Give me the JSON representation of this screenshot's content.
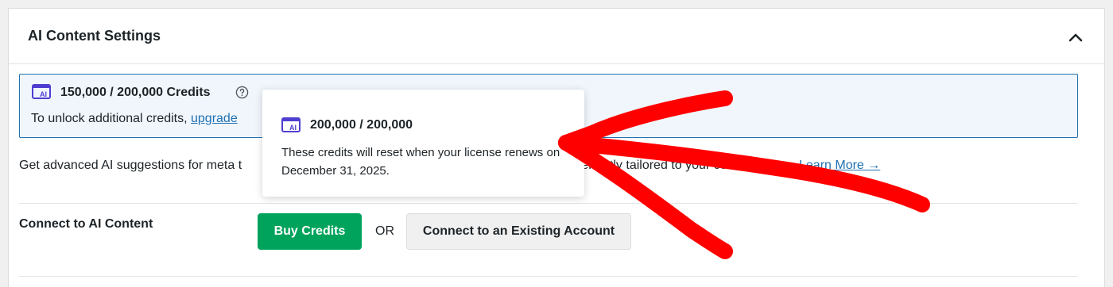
{
  "panel": {
    "title": "AI Content Settings"
  },
  "notice": {
    "credits": "150,000 / 200,000 Credits",
    "unlock_text": "To unlock additional credits, ",
    "upgrade_link": "upgrade"
  },
  "tooltip": {
    "title": "200,000 / 200,000",
    "body": "These credits will reset when your license renews on December 31, 2025."
  },
  "description": {
    "text_left": "Get advanced AI suggestions for meta t",
    "text_mid": "all perfectly tailored to your cont",
    "learn_more": "Learn More →"
  },
  "connect": {
    "label": "Connect to AI Content",
    "buy_button": "Buy Credits",
    "or_text": "OR",
    "existing_button": "Connect to an Existing Account"
  },
  "colors": {
    "accent": "#2271b1",
    "buy_button": "#00a35c",
    "annotation_arrow": "#ff0000",
    "ai_icon": "#4f3fd1"
  },
  "icons": {
    "collapse": "chevron-up-icon",
    "credits": "ai-card-icon",
    "help": "question-circle-icon"
  }
}
